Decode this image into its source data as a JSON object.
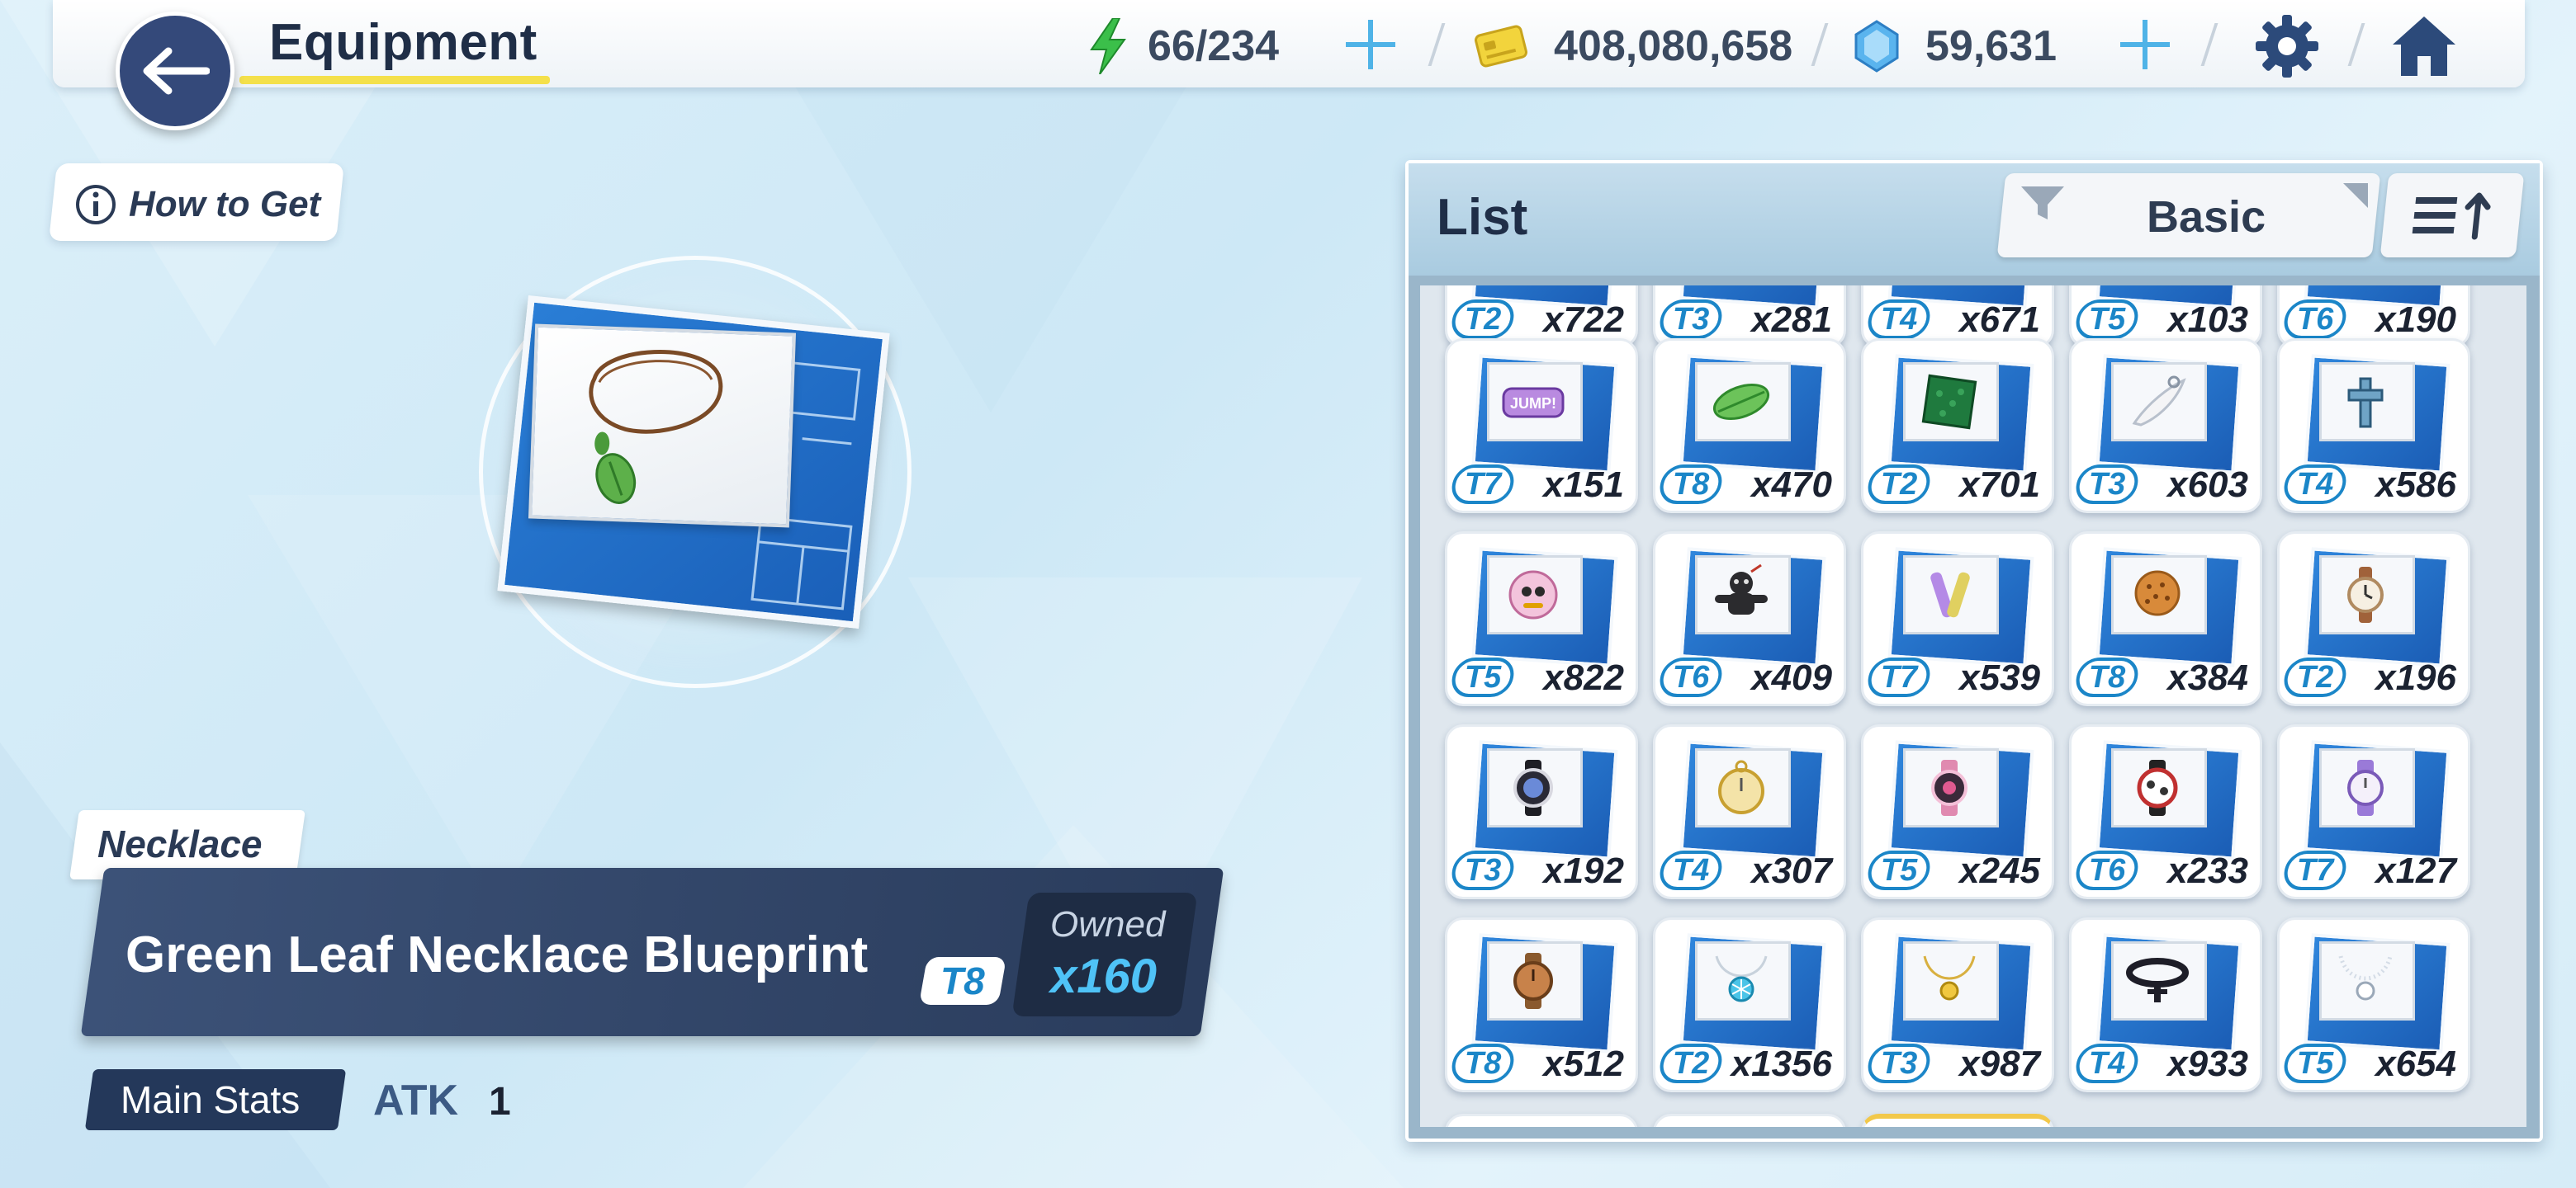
{
  "header": {
    "title": "Equipment",
    "stamina": "66/234",
    "credits": "408,080,658",
    "gems": "59,631"
  },
  "how_to_get": "How to Get",
  "item": {
    "category": "Necklace",
    "name": "Green Leaf Necklace Blueprint",
    "tier": "T8",
    "owned_label": "Owned",
    "owned_count": "x160",
    "main_stats_label": "Main Stats",
    "stat_name": "ATK",
    "stat_value": "1"
  },
  "list": {
    "title": "List",
    "filter_label": "Basic",
    "rows": [
      [
        {
          "tier": "T2",
          "qty": "x722",
          "icon": "partial"
        },
        {
          "tier": "T3",
          "qty": "x281",
          "icon": "partial"
        },
        {
          "tier": "T4",
          "qty": "x671",
          "icon": "partial"
        },
        {
          "tier": "T5",
          "qty": "x103",
          "icon": "partial"
        },
        {
          "tier": "T6",
          "qty": "x190",
          "icon": "partial"
        }
      ],
      [
        {
          "tier": "T7",
          "qty": "x151",
          "icon": "jump-badge-icon"
        },
        {
          "tier": "T8",
          "qty": "x470",
          "icon": "leaf-icon"
        },
        {
          "tier": "T2",
          "qty": "x701",
          "icon": "green-square-icon"
        },
        {
          "tier": "T3",
          "qty": "x603",
          "icon": "feather-icon"
        },
        {
          "tier": "T4",
          "qty": "x586",
          "icon": "cross-icon"
        }
      ],
      [
        {
          "tier": "T5",
          "qty": "x822",
          "icon": "pin-badge-icon"
        },
        {
          "tier": "T6",
          "qty": "x409",
          "icon": "voodoo-doll-icon"
        },
        {
          "tier": "T7",
          "qty": "x539",
          "icon": "glowstick-icon"
        },
        {
          "tier": "T8",
          "qty": "x384",
          "icon": "cookie-icon"
        },
        {
          "tier": "T2",
          "qty": "x196",
          "icon": "watch-icon"
        }
      ],
      [
        {
          "tier": "T3",
          "qty": "x192",
          "icon": "black-watch-icon"
        },
        {
          "tier": "T4",
          "qty": "x307",
          "icon": "pocket-watch-icon"
        },
        {
          "tier": "T5",
          "qty": "x245",
          "icon": "pink-watch-icon"
        },
        {
          "tier": "T6",
          "qty": "x233",
          "icon": "chrono-watch-icon"
        },
        {
          "tier": "T7",
          "qty": "x127",
          "icon": "purple-watch-icon"
        }
      ],
      [
        {
          "tier": "T8",
          "qty": "x512",
          "icon": "bronze-watch-icon"
        },
        {
          "tier": "T2",
          "qty": "x1356",
          "icon": "snowflake-necklace-icon"
        },
        {
          "tier": "T3",
          "qty": "x987",
          "icon": "gold-necklace-icon"
        },
        {
          "tier": "T4",
          "qty": "x933",
          "icon": "choker-icon"
        },
        {
          "tier": "T5",
          "qty": "x654",
          "icon": "pearl-necklace-icon"
        }
      ]
    ]
  },
  "colors": {
    "accent_blue": "#1b86c8",
    "dark_navy": "#2a3c5c",
    "owned_cyan": "#4fc3f7",
    "title_underline": "#f4e04b"
  }
}
